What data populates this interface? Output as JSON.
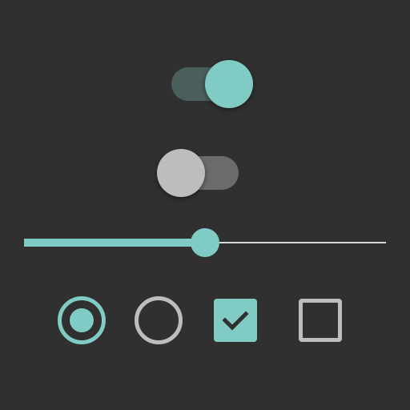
{
  "colors": {
    "background": "#303030",
    "accent": "#80cbc4",
    "accent_track": "#4a5e5b",
    "inactive_thumb": "#bdbdbd",
    "inactive_track": "#6b6b6b",
    "outline": "#bdbdbd",
    "rail": "#d8d8d8"
  },
  "switches": [
    {
      "name": "switch-on",
      "state": "on"
    },
    {
      "name": "switch-off",
      "state": "off"
    }
  ],
  "slider": {
    "value": 0.5,
    "min": 0,
    "max": 1
  },
  "radios": [
    {
      "name": "radio-selected",
      "checked": true
    },
    {
      "name": "radio-unselected",
      "checked": false
    }
  ],
  "checkboxes": [
    {
      "name": "checkbox-checked",
      "checked": true,
      "icon": "check-icon"
    },
    {
      "name": "checkbox-unchecked",
      "checked": false
    }
  ]
}
